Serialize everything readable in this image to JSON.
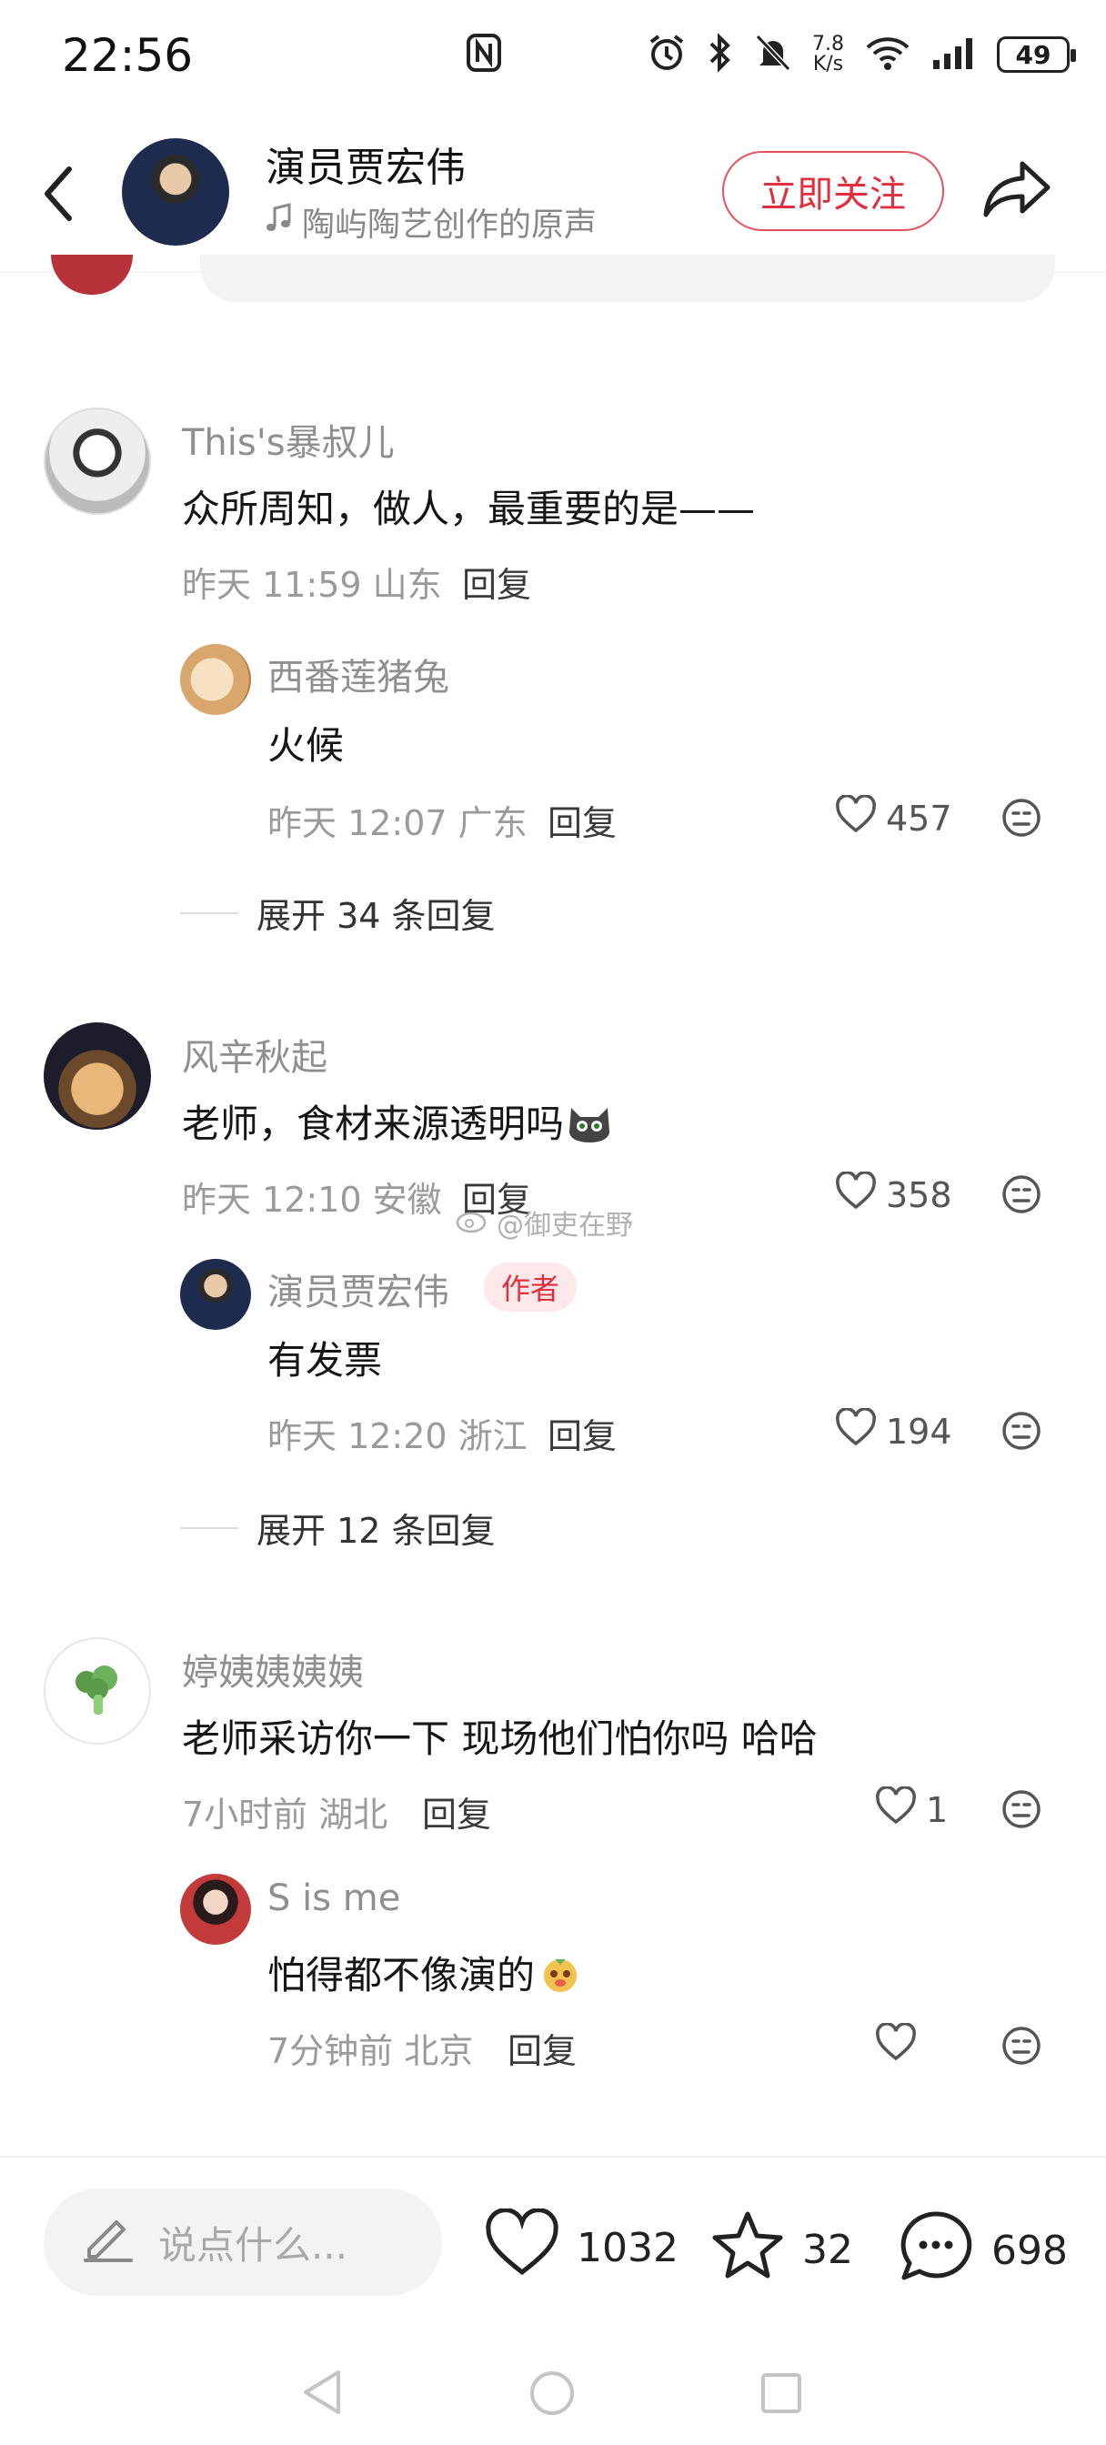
{
  "status_bar": {
    "time": "22:56",
    "speed_value": "7.8",
    "speed_unit": "K/s",
    "battery": "49"
  },
  "header": {
    "name": "演员贾宏伟",
    "subtitle": "陶屿陶艺创作的原声",
    "follow_label": "立即关注"
  },
  "comments": [
    {
      "user": "This's暴叔儿",
      "text": "众所周知，做人，最重要的是——",
      "meta": "昨天 11:59 山东",
      "reply_label": "回复",
      "replies": [
        {
          "user": "西番莲猪兔",
          "text": "火候",
          "meta": "昨天 12:07 广东",
          "reply_label": "回复",
          "likes": "457"
        }
      ],
      "expand_label": "展开 34 条回复"
    },
    {
      "user": "风辛秋起",
      "text": "老师，食材来源透明吗",
      "meta": "昨天 12:10 安徽",
      "reply_label": "回复",
      "likes": "358",
      "replies": [
        {
          "user": "演员贾宏伟",
          "badge": "作者",
          "text": "有发票",
          "meta": "昨天 12:20 浙江",
          "reply_label": "回复",
          "likes": "194"
        }
      ],
      "expand_label": "展开 12 条回复"
    },
    {
      "user": "婷姨姨姨姨",
      "text": "老师采访你一下 现场他们怕你吗 哈哈",
      "meta": "7小时前 湖北",
      "reply_label": "回复",
      "likes": "1",
      "replies": [
        {
          "user": "S is me",
          "text": "怕得都不像演的",
          "meta": "7分钟前 北京",
          "reply_label": "回复",
          "likes": ""
        }
      ]
    }
  ],
  "watermark": "@御吏在野",
  "bottom_bar": {
    "input_placeholder": "说点什么...",
    "likes": "1032",
    "favorites": "32",
    "comments": "698"
  },
  "icons": [
    "nfc-icon",
    "alarm-icon",
    "bluetooth-icon",
    "mute-icon",
    "wifi-icon",
    "signal-icon",
    "back-icon",
    "music-note-icon",
    "share-icon",
    "heart-icon",
    "emoji-icon",
    "pencil-icon",
    "star-icon",
    "comment-icon",
    "nav-back-icon",
    "nav-home-icon",
    "nav-recents-icon"
  ],
  "colors": {
    "accent": "#e0303f",
    "badge_bg": "#fde8ea",
    "secondary_text": "#9a9a9a"
  }
}
